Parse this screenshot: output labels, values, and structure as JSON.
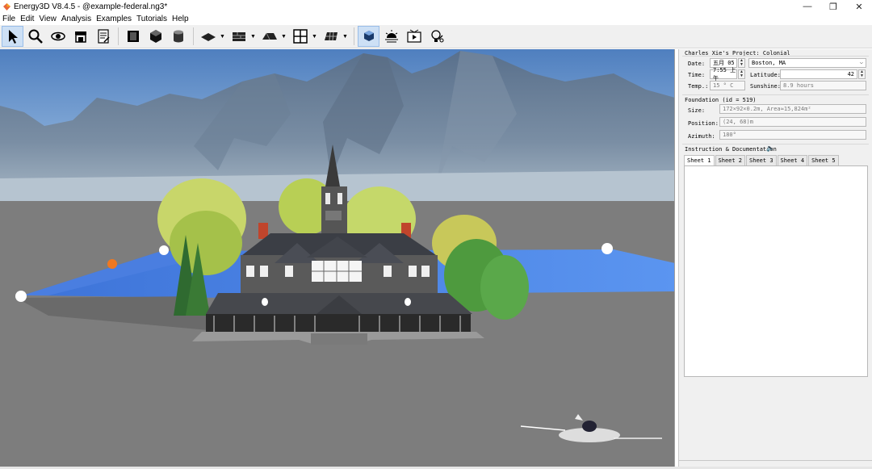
{
  "window": {
    "title": "Energy3D V8.4.5 - @example-federal.ng3*",
    "controls": [
      "minimize-icon",
      "restore-icon",
      "close-icon"
    ]
  },
  "menu": [
    "File",
    "Edit",
    "View",
    "Analysis",
    "Examples",
    "Tutorials",
    "Help"
  ],
  "toolbar": {
    "tools": [
      {
        "name": "select-arrow-icon",
        "active": true
      },
      {
        "name": "zoom-icon"
      },
      {
        "name": "rotate-view-icon"
      },
      {
        "name": "store-icon"
      },
      {
        "name": "notes-icon"
      },
      {
        "name": "panel-icon"
      },
      {
        "name": "cube-icon"
      },
      {
        "name": "cylinder-icon"
      },
      {
        "name": "foundation-icon",
        "dropdown": true
      },
      {
        "name": "wall-icon",
        "dropdown": true
      },
      {
        "name": "roof-icon",
        "dropdown": true
      },
      {
        "name": "window-icon",
        "dropdown": true
      },
      {
        "name": "solar-panel-icon",
        "dropdown": true
      },
      {
        "name": "shadow-cube-icon",
        "active": true
      },
      {
        "name": "sun-icon"
      },
      {
        "name": "animation-icon"
      },
      {
        "name": "heliodon-icon"
      }
    ]
  },
  "colors": {
    "sky": "#5e8fc7",
    "ground": "#7d7d7d",
    "water": "#4f86e8",
    "accent": "#cde0f5"
  },
  "panel": {
    "project_title": "Charles Xie's  Project: Colonial",
    "date_label": "Date:",
    "date_value": "五月 05",
    "location_value": "Boston, MA",
    "time_label": "Time:",
    "time_value": "7:55 上午",
    "latitude_label": "Latitude:",
    "latitude_value": "42",
    "temp_label": "Temp.:",
    "temp_value": "15 ° C",
    "sunshine_label": "Sunshine:",
    "sunshine_value": "8.9 hours",
    "foundation_title": "Foundation (id = 519)",
    "size_label": "Size:",
    "size_value": "172×92×0.2m,  Area≈15,824m²",
    "position_label": "Position:",
    "position_value": "(24,  68)m",
    "azimuth_label": "Azimuth:",
    "azimuth_value": "180°",
    "instruction_title": "Instruction & Documentation",
    "tabs": [
      "Sheet 1",
      "Sheet 2",
      "Sheet 3",
      "Sheet 4",
      "Sheet 5"
    ],
    "active_tab": 0
  }
}
